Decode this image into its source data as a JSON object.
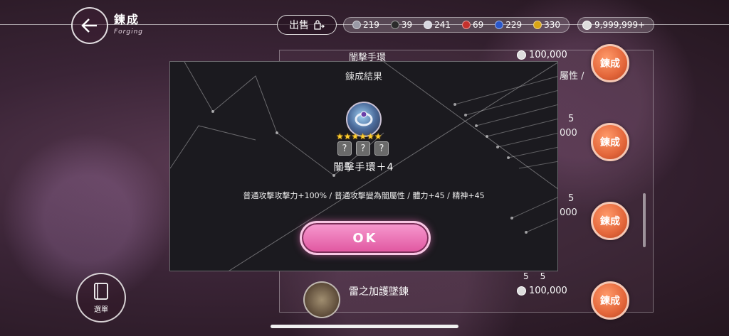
{
  "header": {
    "title": "鍊成",
    "subtitle": "Forging",
    "sell_label": "出售"
  },
  "resources": [
    {
      "name": "silver-ore",
      "color": "#9a9aa6",
      "value": "219"
    },
    {
      "name": "dark-gem",
      "color": "#2b2b2b",
      "value": "39"
    },
    {
      "name": "crystal",
      "color": "#d7d7e0",
      "value": "241"
    },
    {
      "name": "red-gem",
      "color": "#c4312d",
      "value": "69"
    },
    {
      "name": "blue-gem",
      "color": "#2a57c9",
      "value": "229"
    },
    {
      "name": "gold-gem",
      "color": "#d9a514",
      "value": "330"
    }
  ],
  "money": "9,999,999+",
  "background_list": {
    "top_item_name": "闇擊手環",
    "top_item_price": "100,000",
    "partial_label": "屬性 /",
    "forge_label": "鍊成",
    "row2_count": "5",
    "row2_price": "000",
    "row3_count": "5",
    "row3_price": "000",
    "bottom_item_name": "雷之加護墜鍊",
    "bottom_item_price": "100,000",
    "bottom_count_a": "5",
    "bottom_count_b": "5"
  },
  "menu": {
    "label": "選單"
  },
  "modal": {
    "title": "鍊成結果",
    "stars": "★★★★★★",
    "qbox": "?",
    "item_name": "闇擊手環＋4",
    "description": "普通攻擊攻擊力+100% / 普通攻擊變為闇屬性 / 體力+45 / 精神+45",
    "ok_label": "OK"
  }
}
